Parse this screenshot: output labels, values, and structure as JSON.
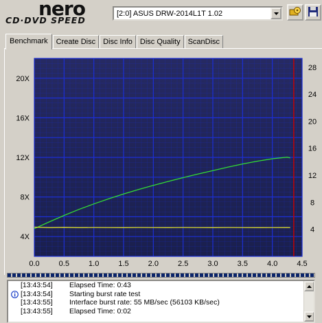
{
  "app": {
    "logo_text": "nero",
    "logo_subtitle": "CD·DVD SPEED"
  },
  "drive": {
    "selected": "[2:0]  ASUS DRW-2014L1T 1.02"
  },
  "toolbar": {
    "icons": [
      "drive-settings-icon",
      "save-icon"
    ]
  },
  "tabs": [
    {
      "label": "Benchmark",
      "active": true
    },
    {
      "label": "Create Disc",
      "active": false
    },
    {
      "label": "Disc Info",
      "active": false
    },
    {
      "label": "Disc Quality",
      "active": false
    },
    {
      "label": "ScanDisc",
      "active": false
    }
  ],
  "chart_data": {
    "type": "line",
    "x_ticks": [
      "0.0",
      "0.5",
      "1.0",
      "1.5",
      "2.0",
      "2.5",
      "3.0",
      "3.5",
      "4.0",
      "4.5"
    ],
    "y_left_ticks": [
      "4X",
      "8X",
      "12X",
      "16X",
      "20X"
    ],
    "y_right_ticks": [
      "4",
      "8",
      "12",
      "16",
      "20",
      "24",
      "28"
    ],
    "xlim": [
      0,
      4.5
    ],
    "y_left_lim": [
      2,
      22
    ],
    "y_right_lim": [
      0,
      29.3
    ],
    "grid": true,
    "end_marker_x": 4.36,
    "colors": {
      "background": "#1a1f4e",
      "grid": "#1c2fd6",
      "speed": "#33dd33",
      "rpm": "#d8d830",
      "marker": "#cc0000"
    },
    "series": [
      {
        "x": [
          0,
          0.25,
          0.5,
          0.75,
          1.0,
          1.25,
          1.5,
          1.75,
          2.0,
          2.25,
          2.5,
          2.75,
          3.0,
          3.25,
          3.5,
          3.75,
          4.0,
          4.25,
          4.3
        ],
        "values": [
          4.8,
          5.48,
          6.13,
          6.74,
          7.3,
          7.82,
          8.3,
          8.75,
          9.17,
          9.57,
          9.95,
          10.32,
          10.67,
          11.01,
          11.33,
          11.62,
          11.86,
          12.02,
          11.95
        ]
      },
      {
        "x": [
          0,
          0.25,
          0.5,
          0.75,
          1.0,
          1.25,
          1.5,
          1.75,
          2.0,
          2.25,
          2.5,
          2.75,
          3.0,
          3.25,
          3.5,
          3.75,
          4.0,
          4.25,
          4.3
        ],
        "values": [
          4.95,
          4.9,
          4.93,
          4.9,
          4.92,
          4.91,
          4.9,
          4.92,
          4.91,
          4.9,
          4.92,
          4.91,
          4.9,
          4.92,
          4.91,
          4.9,
          4.91,
          4.92,
          4.9
        ]
      }
    ]
  },
  "log": [
    {
      "time": "[13:43:54]",
      "message": "Elapsed Time:  0:43",
      "icon": ""
    },
    {
      "time": "[13:43:54]",
      "message": "Starting burst rate test",
      "icon": "info-icon"
    },
    {
      "time": "[13:43:55]",
      "message": "Interface burst rate: 55 MB/sec (56103 KB/sec)",
      "icon": ""
    },
    {
      "time": "[13:43:55]",
      "message": "Elapsed Time:  0:02",
      "icon": ""
    }
  ]
}
